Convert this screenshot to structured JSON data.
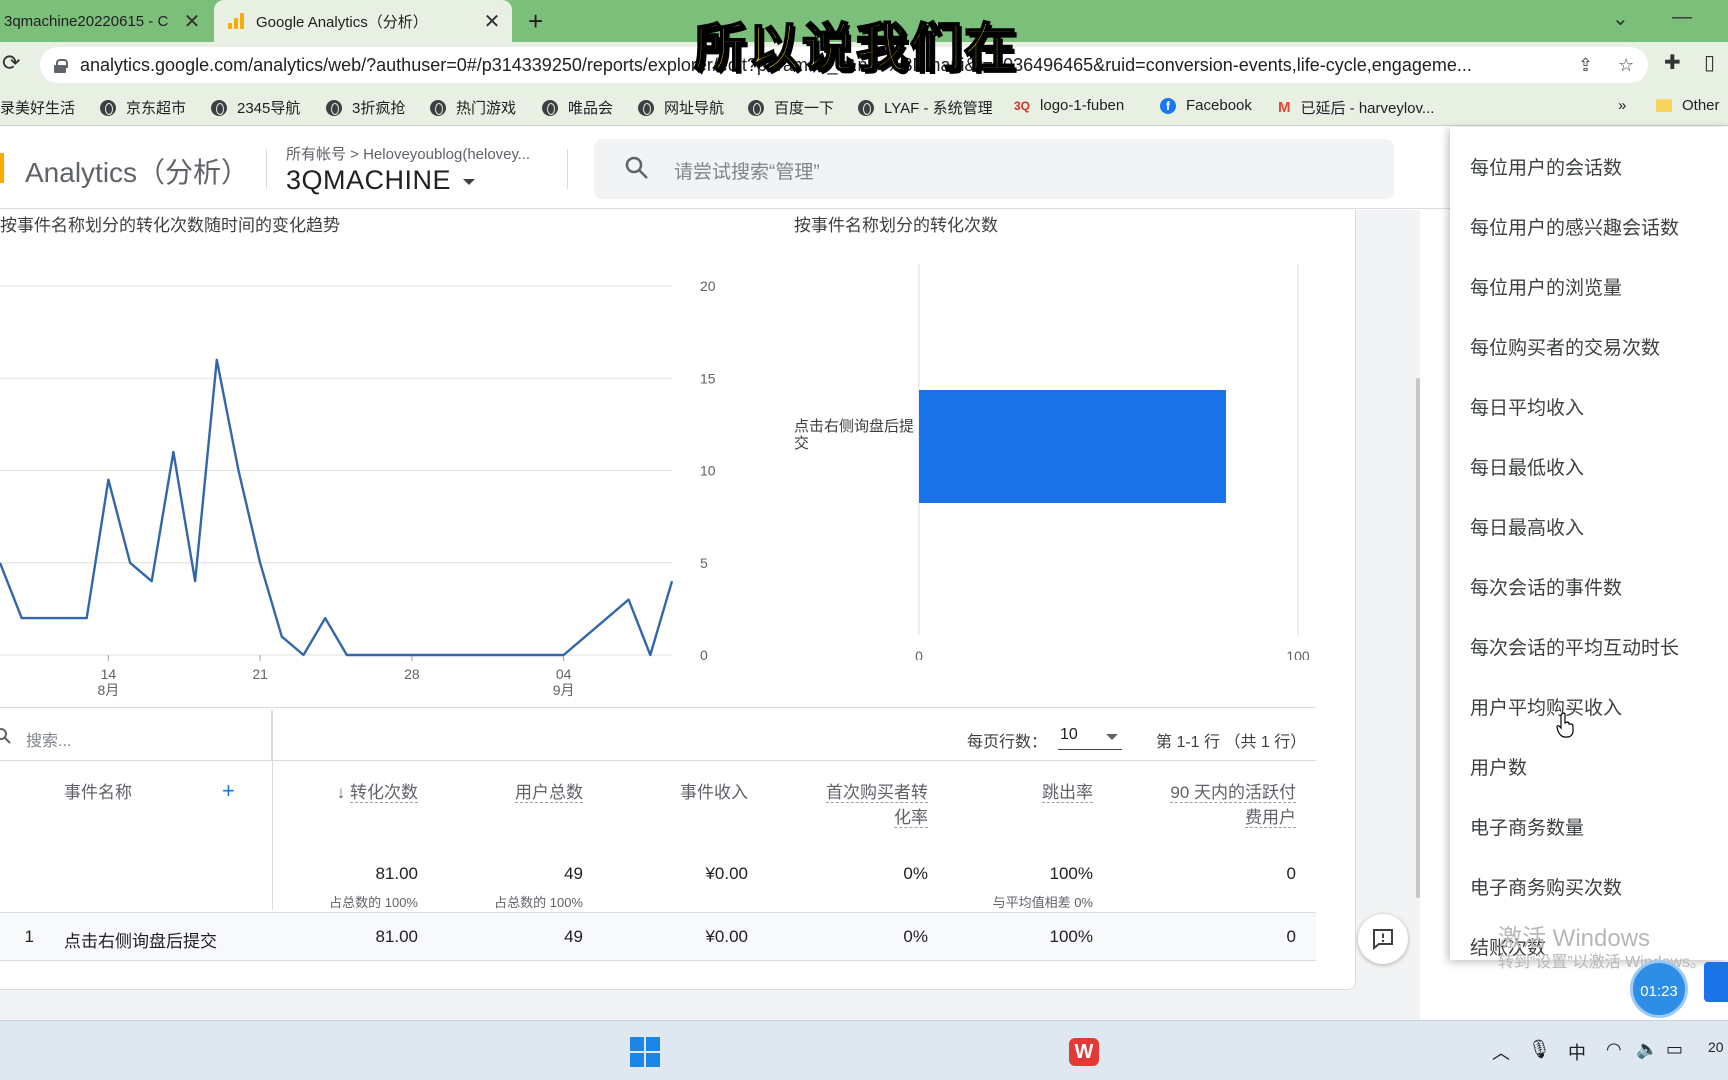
{
  "browser": {
    "tabs": [
      {
        "title": "3qmachine20220615 - C",
        "active": false
      },
      {
        "title": "Google Analytics（分析）",
        "active": true
      }
    ],
    "new_tab_glyph": "+",
    "close_glyph": "✕",
    "url": "analytics.google.com/analytics/web/?authuser=0#/p314339250/reports/explorer/edit?params=_u..nav%3Dmaui&r=4036496465&ruid=conversion-events,life-cycle,engageme...",
    "bookmarks": [
      {
        "label": "录美好生活",
        "icon": "none"
      },
      {
        "label": "京东超市",
        "icon": "globe-icon"
      },
      {
        "label": "2345导航",
        "icon": "globe-icon"
      },
      {
        "label": "3折疯抢",
        "icon": "globe-icon"
      },
      {
        "label": "热门游戏",
        "icon": "globe-icon"
      },
      {
        "label": "唯品会",
        "icon": "globe-icon"
      },
      {
        "label": "网址导航",
        "icon": "globe-icon"
      },
      {
        "label": "百度一下",
        "icon": "globe-icon"
      },
      {
        "label": "LYAF - 系统管理",
        "icon": "globe-icon"
      },
      {
        "label": "logo-1-fuben",
        "icon": "3q-icon"
      },
      {
        "label": "Facebook",
        "icon": "facebook-icon"
      },
      {
        "label": "已延后 - harveylov...",
        "icon": "gmail-icon"
      }
    ],
    "bookmarks_overflow": "»",
    "other_bookmarks": "Other"
  },
  "ga": {
    "product": "Analytics（分析）",
    "account_crumb": "所有帐号 > Heloveyoublog(heloveу...",
    "account_name": "3QMACHINE",
    "search_placeholder": "请尝试搜索“管理”"
  },
  "line_chart": {
    "title": "按事件名称划分的转化次数随时间的变化趋势",
    "x_tick_labels": [
      {
        "day": "14",
        "month": "8月"
      },
      {
        "day": "21",
        "month": ""
      },
      {
        "day": "28",
        "month": ""
      },
      {
        "day": "04",
        "month": "9月"
      }
    ]
  },
  "bar_chart": {
    "title": "按事件名称划分的转化次数",
    "category_label": "点击右侧询盘后提交"
  },
  "chart_data": [
    {
      "type": "line",
      "title": "按事件名称划分的转化次数随时间的变化趋势",
      "xlabel": "",
      "ylabel": "",
      "y_ticks": [
        0,
        5,
        10,
        15,
        20
      ],
      "ylim": [
        0,
        20
      ],
      "y_axis_side": "right",
      "grid": true,
      "x_day_of_series_start": 9,
      "x_tick_days": [
        14,
        21,
        28,
        35
      ],
      "series": [
        {
          "name": "点击右侧询盘后提交",
          "values": [
            5,
            2,
            2,
            2,
            2,
            9.5,
            5,
            4,
            11,
            4,
            16,
            10,
            5,
            1,
            0,
            2,
            0,
            0,
            0,
            0,
            0,
            0,
            0,
            0,
            0,
            0,
            0,
            1,
            2,
            3,
            0,
            4
          ]
        }
      ],
      "color": "#3366aa"
    },
    {
      "type": "bar",
      "orientation": "horizontal",
      "title": "按事件名称划分的转化次数",
      "categories": [
        "点击右侧询盘后提交"
      ],
      "values": [
        81
      ],
      "x_ticks": [
        0,
        100
      ],
      "xlim": [
        0,
        100
      ],
      "color": "#1a73e8"
    }
  ],
  "table": {
    "search_placeholder": "搜索...",
    "rows_per_page_label": "每页行数：",
    "rows_per_page_value": "10",
    "pager": "第 1-1 行 （共 1 行）",
    "headers": {
      "event_name": "事件名称",
      "add": "+",
      "conversions": "转化次数",
      "total_users": "用户总数",
      "event_revenue": "事件收入",
      "first_purchaser_rate_1": "首次购买者转",
      "first_purchaser_rate_2": "化率",
      "bounce_rate": "跳出率",
      "active_paying_1": "90 天内的活跃付",
      "active_paying_2": "费用户"
    },
    "sort_glyph": "↓",
    "totals": {
      "conversions": "81.00",
      "conversions_sub": "占总数的 100%",
      "total_users": "49",
      "total_users_sub": "占总数的 100%",
      "event_revenue": "¥0.00",
      "first_purchaser_rate": "0%",
      "bounce_rate": "100%",
      "bounce_rate_sub": "与平均值相差 0%",
      "active_paying": "0"
    },
    "rows": [
      {
        "index": "1",
        "event_name": "点击右侧询盘后提交",
        "conversions": "81.00",
        "total_users": "49",
        "event_revenue": "¥0.00",
        "first_purchaser_rate": "0%",
        "bounce_rate": "100%",
        "active_paying": "0"
      }
    ]
  },
  "dropdown_items": [
    "每位用户的会话数",
    "每位用户的感兴趣会话数",
    "每位用户的浏览量",
    "每位购买者的交易次数",
    "每日平均收入",
    "每日最低收入",
    "每日最高收入",
    "每次会话的事件数",
    "每次会话的平均互动时长",
    "用户平均购买收入",
    "用户数",
    "电子商务数量",
    "电子商务购买次数",
    "结账次数"
  ],
  "overlay": {
    "watermark_1": "激活 Windows",
    "watermark_2": "转到“设置”以激活 Windows。",
    "timer": "01:23",
    "subtitle": "所以说我们在",
    "wps": "W"
  },
  "taskbar": {
    "ime": "中",
    "clock_partial": "20"
  },
  "colors": {
    "chrome_green": "#7cbf7a",
    "chrome_toolbar": "#e8f0e4",
    "ga_orange": "#f9ab00",
    "ga_blue": "#1a73e8",
    "line_blue": "#3366aa"
  }
}
